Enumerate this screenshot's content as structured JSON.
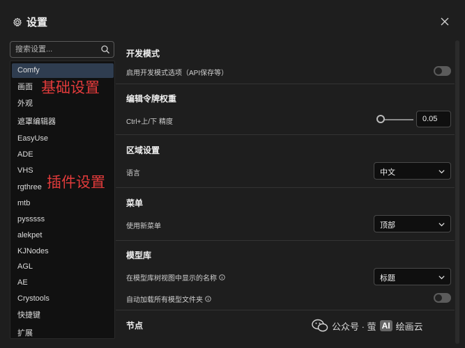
{
  "header": {
    "title": "设置",
    "close_label": "×"
  },
  "search": {
    "placeholder": "搜索设置..."
  },
  "sidebar": {
    "items": [
      {
        "label": "Comfy",
        "active": true
      },
      {
        "label": "画面"
      },
      {
        "label": "外观"
      },
      {
        "label": "遮罩编辑器"
      },
      {
        "label": "EasyUse"
      },
      {
        "label": "ADE"
      },
      {
        "label": "VHS"
      },
      {
        "label": "rgthree"
      },
      {
        "label": "mtb"
      },
      {
        "label": "pysssss"
      },
      {
        "label": "alekpet"
      },
      {
        "label": "KJNodes"
      },
      {
        "label": "AGL"
      },
      {
        "label": "AE"
      },
      {
        "label": "Crystools"
      },
      {
        "label": "快捷键"
      },
      {
        "label": "扩展"
      }
    ]
  },
  "annotations": {
    "basic": "基础设置",
    "plugins": "插件设置"
  },
  "sections": {
    "dev": {
      "title": "开发模式",
      "option_label": "启用开发模式选项（API保存等）",
      "enabled": false
    },
    "token": {
      "title": "编辑令牌权重",
      "option_label": "Ctrl+上/下 精度",
      "value": "0.05",
      "slider_level": 0
    },
    "region": {
      "title": "区域设置",
      "option_label": "语言",
      "selected": "中文"
    },
    "menu": {
      "title": "菜单",
      "option_label": "使用新菜单",
      "selected": "顶部"
    },
    "model": {
      "title": "模型库",
      "name_label": "在模型库树视图中显示的名称",
      "name_selected": "标题",
      "autoload_label": "自动加载所有模型文件夹",
      "autoload_enabled": false
    },
    "node": {
      "title": "节点"
    }
  },
  "watermark": {
    "text_a": "公众号 · 萤",
    "ai": "AI",
    "text_b": "绘画云"
  },
  "colors": {
    "background": "#1e1e1e",
    "sidebar_bg": "#111111",
    "active_item": "#2f3d50",
    "annotation": "#e23b3b"
  },
  "icons": {
    "title": "gear-icon",
    "close": "close-icon",
    "search": "search-icon",
    "select": "chevron-down-icon",
    "info": "info-icon"
  }
}
